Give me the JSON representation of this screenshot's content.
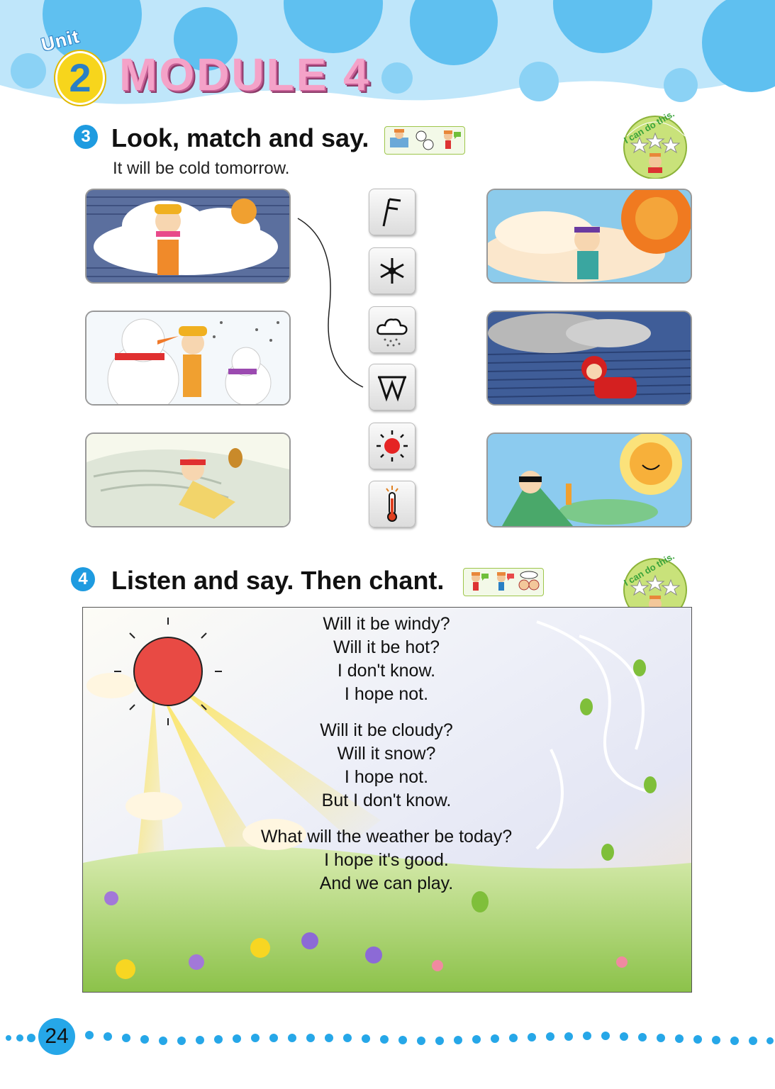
{
  "header": {
    "unit_word": "Unit",
    "unit_number": "2",
    "module_title": "MODULE 4",
    "bubble_color": "#7fcaf2",
    "accent_pink": "#f4a2c8"
  },
  "section3": {
    "number": "3",
    "title": "Look, match and say.",
    "subtitle": "It will be cold tomorrow.",
    "can_do_text": "I can do this.",
    "left_pictures": [
      "cold-girl-picture",
      "snowman-girl-picture",
      "windy-man-picture"
    ],
    "symbols": [
      "windy-symbol-icon",
      "snowflake-icon",
      "rain-cloud-icon",
      "wind-symbol-icon",
      "sun-icon",
      "thermometer-icon"
    ],
    "right_pictures": [
      "hot-sun-boy-picture",
      "rainy-boy-picture",
      "sunny-beach-boy-picture"
    ]
  },
  "section4": {
    "number": "4",
    "title": "Listen and say. Then chant.",
    "can_do_text": "I can do this.",
    "stanzas": [
      [
        "Will it be windy?",
        "Will it be hot?",
        "I don't know.",
        "I hope not."
      ],
      [
        "Will it be cloudy?",
        "Will it snow?",
        "I hope not.",
        "But I don't know."
      ],
      [
        "What will the weather be today?",
        "I hope it's good.",
        "And we can play."
      ]
    ]
  },
  "footer": {
    "page_number": "24",
    "dot_color": "#26a7e8"
  }
}
